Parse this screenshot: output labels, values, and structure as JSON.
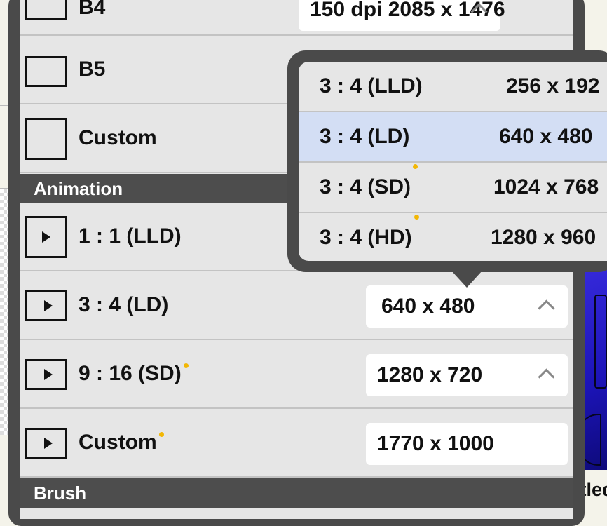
{
  "rows": {
    "b4": {
      "label": "B4",
      "value": "150 dpi  2085 x 1476"
    },
    "b5": {
      "label": "B5"
    },
    "custom_print": {
      "label": "Custom"
    },
    "anim_lld": {
      "label": "1 : 1 (LLD)"
    },
    "anim_ld": {
      "label": "3 : 4 (LD)",
      "value": "640 x  480"
    },
    "anim_sd": {
      "label": "9 : 16 (SD)",
      "value": "1280 x  720"
    },
    "anim_custom": {
      "label": "Custom",
      "value": "1770 x 1000"
    }
  },
  "sections": {
    "animation": "Animation",
    "brush": "Brush"
  },
  "popover": {
    "options": [
      {
        "label": "3 : 4 (LLD)",
        "size": "256 x  192",
        "premium": false
      },
      {
        "label": "3 : 4 (LD)",
        "size": "640 x  480",
        "premium": false,
        "selected": true
      },
      {
        "label": "3 : 4 (SD)",
        "size": "1024 x  768",
        "premium": true
      },
      {
        "label": "3 : 4 (HD)",
        "size": "1280 x  960",
        "premium": true
      }
    ]
  },
  "background": {
    "window_title_fragment": "itled"
  },
  "colors": {
    "panel": "#4a4a4a",
    "list_bg": "#e6e6e6",
    "selected_option": "#d3def4",
    "premium_dot": "#f2b705"
  }
}
